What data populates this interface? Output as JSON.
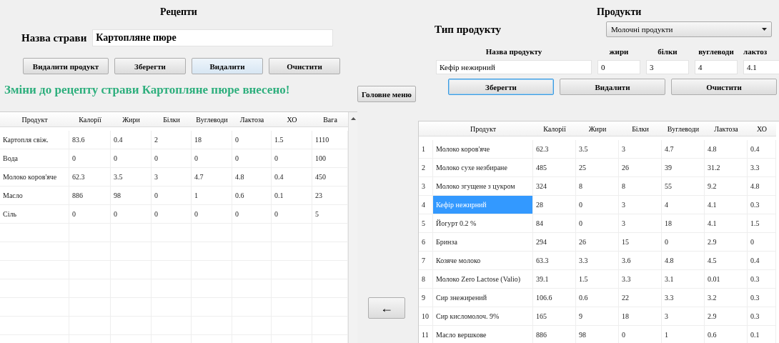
{
  "recipes": {
    "title": "Рецепти",
    "dish_label": "Назва страви",
    "dish_name": "Картопляне пюре",
    "buttons": [
      {
        "label": "Видалити продукт",
        "hover": false
      },
      {
        "label": "Зберегти",
        "hover": false
      },
      {
        "label": "Видалити",
        "hover": true
      },
      {
        "label": "Очистити",
        "hover": false
      }
    ],
    "message": "Зміни до рецепту страви  Картопляне пюре внесено!",
    "table": {
      "columns": [
        "Продукт",
        "Калорії",
        "Жири",
        "Білки",
        "Вуглеводи",
        "Лактоза",
        "ХО",
        "Вага"
      ],
      "rows": [
        [
          "Картопля свіж.",
          "83.6",
          "0.4",
          "2",
          "18",
          "0",
          "1.5",
          "1110"
        ],
        [
          "Вода",
          "0",
          "0",
          "0",
          "0",
          "0",
          "0",
          "100"
        ],
        [
          "Молоко коров'яче",
          "62.3",
          "3.5",
          "3",
          "4.7",
          "4.8",
          "0.4",
          "450"
        ],
        [
          "Масло",
          "886",
          "98",
          "0",
          "1",
          "0.6",
          "0.1",
          "23"
        ],
        [
          "Сіль",
          "0",
          "0",
          "0",
          "0",
          "0",
          "0",
          "5"
        ]
      ]
    }
  },
  "main_menu_button": "Головне меню",
  "add_arrow_button": "←",
  "products": {
    "title": "Продукти",
    "type_label": "Тип продукту",
    "type_value": "Молочні продукти",
    "field_labels": [
      "Назва продукту",
      "жири",
      "білки",
      "вуглеводи",
      "лактоз"
    ],
    "field_values": [
      "Кефір нежирний",
      "0",
      "3",
      "4",
      "4.1"
    ],
    "buttons": [
      {
        "label": "Зберегти",
        "focused": true
      },
      {
        "label": "Видалити",
        "focused": false
      },
      {
        "label": "Очистити",
        "focused": false
      }
    ],
    "table": {
      "columns": [
        "Продукт",
        "Калорії",
        "Жири",
        "Білки",
        "Вуглеводи",
        "Лактоза",
        "ХО"
      ],
      "rows": [
        {
          "index": "1",
          "cells": [
            "Молоко коров'яче",
            "62.3",
            "3.5",
            "3",
            "4.7",
            "4.8",
            "0.4"
          ],
          "selected": false
        },
        {
          "index": "2",
          "cells": [
            "Молоко сухе незбиране",
            "485",
            "25",
            "26",
            "39",
            "31.2",
            "3.3"
          ],
          "selected": false
        },
        {
          "index": "3",
          "cells": [
            "Молоко згущене з цукром",
            "324",
            "8",
            "8",
            "55",
            "9.2",
            "4.8"
          ],
          "selected": false
        },
        {
          "index": "4",
          "cells": [
            "Кефір нежирний",
            "28",
            "0",
            "3",
            "4",
            "4.1",
            "0.3"
          ],
          "selected": true
        },
        {
          "index": "5",
          "cells": [
            "Йогурт 0.2 %",
            "84",
            "0",
            "3",
            "18",
            "4.1",
            "1.5"
          ],
          "selected": false
        },
        {
          "index": "6",
          "cells": [
            "Бринза",
            "294",
            "26",
            "15",
            "0",
            "2.9",
            "0"
          ],
          "selected": false
        },
        {
          "index": "7",
          "cells": [
            "Козяче молоко",
            "63.3",
            "3.3",
            "3.6",
            "4.8",
            "4.5",
            "0.4"
          ],
          "selected": false
        },
        {
          "index": "8",
          "cells": [
            "Молоко Zero Lactose (Valio)",
            "39.1",
            "1.5",
            "3.3",
            "3.1",
            "0.01",
            "0.3"
          ],
          "selected": false
        },
        {
          "index": "9",
          "cells": [
            "Сир знежирений",
            "106.6",
            "0.6",
            "22",
            "3.3",
            "3.2",
            "0.3"
          ],
          "selected": false
        },
        {
          "index": "10",
          "cells": [
            "Сир кисломолоч. 9%",
            "165",
            "9",
            "18",
            "3",
            "2.9",
            "0.3"
          ],
          "selected": false
        },
        {
          "index": "11",
          "cells": [
            "Масло вершкове",
            "886",
            "98",
            "0",
            "1",
            "0.6",
            "0.1"
          ],
          "selected": false
        }
      ]
    }
  }
}
